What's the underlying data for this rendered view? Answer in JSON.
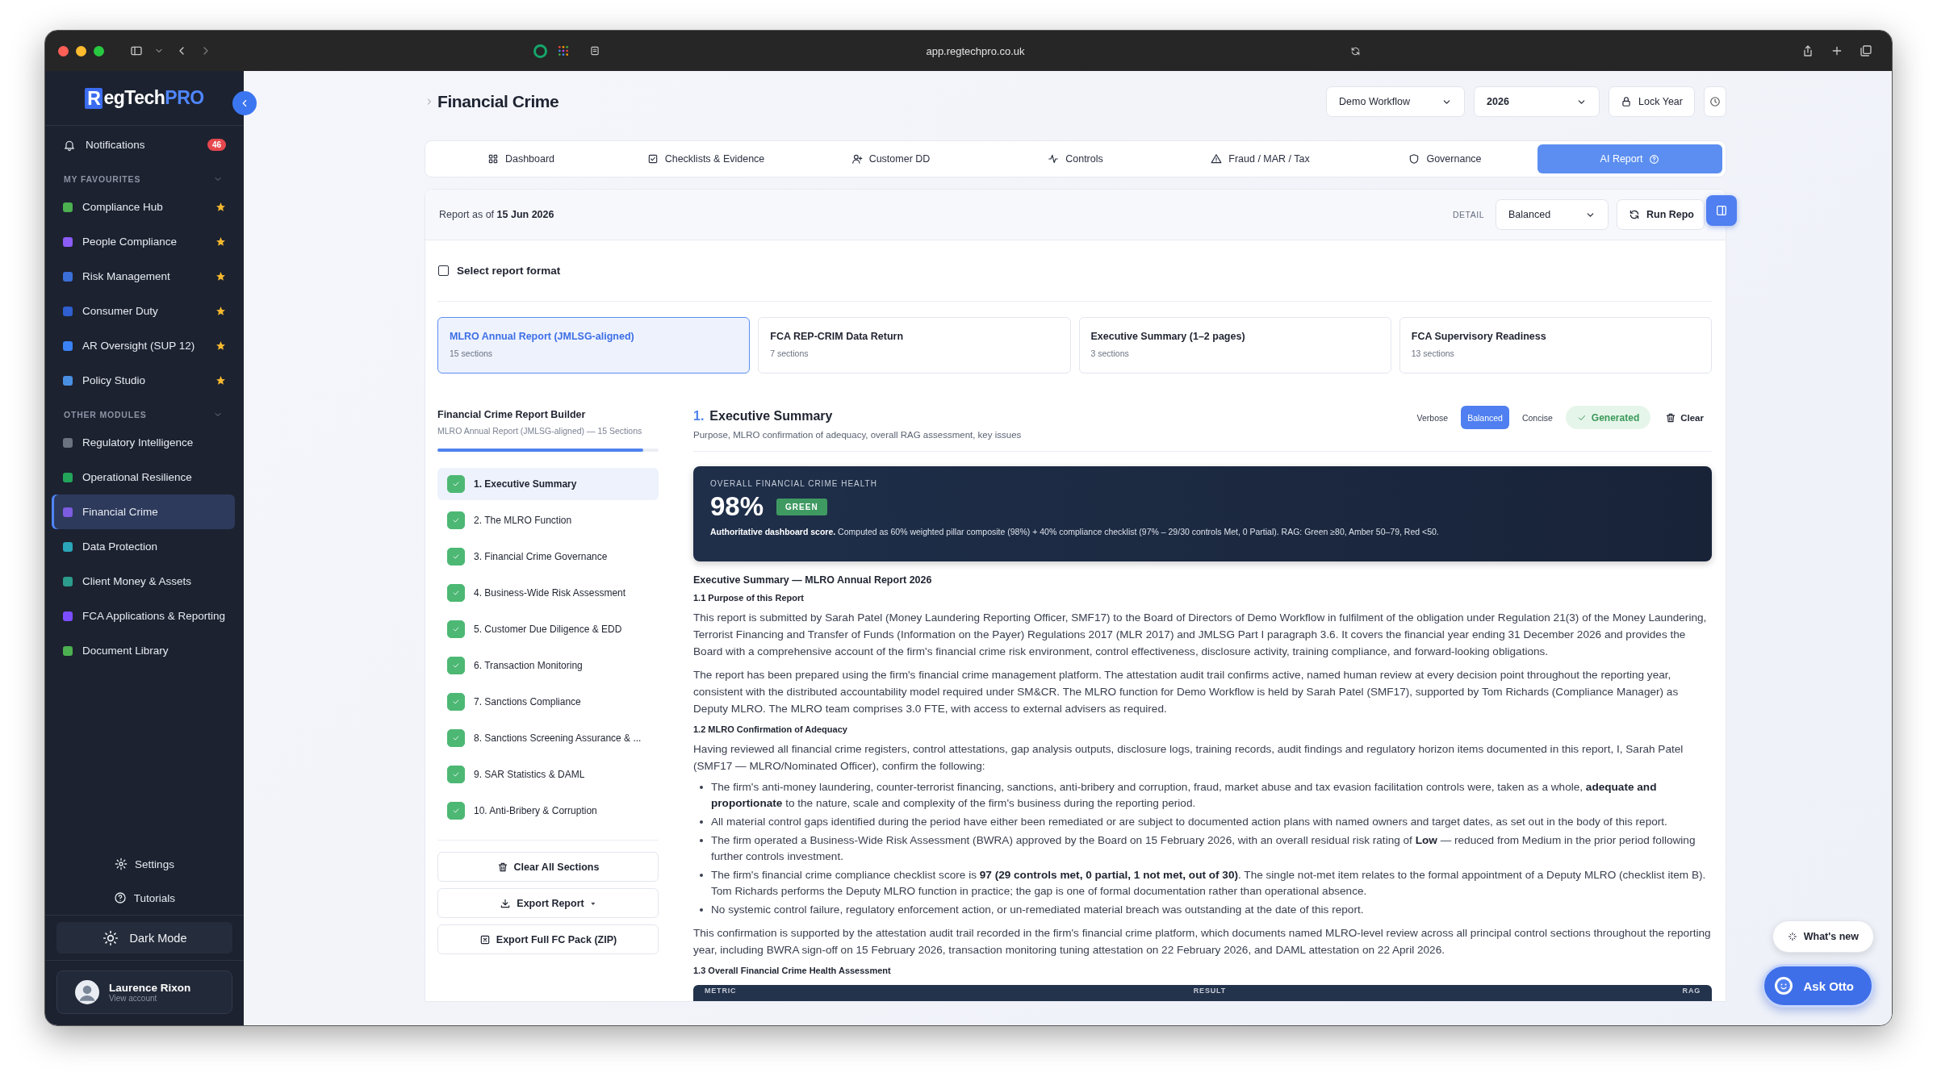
{
  "browser": {
    "url": "app.regtechpro.co.uk"
  },
  "sidebar": {
    "logo_mark": "R",
    "logo_text": "egTech",
    "logo_accent": "PRO",
    "notifications": {
      "label": "Notifications",
      "badge": "46"
    },
    "groups": [
      {
        "title": "MY FAVOURITES",
        "expanded": true,
        "items": [
          {
            "label": "Compliance Hub",
            "color": "#4caf50",
            "starred": true,
            "selected": false
          },
          {
            "label": "People Compliance",
            "color": "#8b5cf6",
            "starred": true,
            "selected": false
          },
          {
            "label": "Risk Management",
            "color": "#3b6fd8",
            "starred": true,
            "selected": false
          },
          {
            "label": "Consumer Duty",
            "color": "#2f5fd0",
            "starred": true,
            "selected": false
          },
          {
            "label": "AR Oversight (SUP 12)",
            "color": "#3b82f6",
            "starred": true,
            "selected": false
          },
          {
            "label": "Policy Studio",
            "color": "#4a90e2",
            "starred": true,
            "selected": false
          }
        ]
      },
      {
        "title": "OTHER MODULES",
        "expanded": true,
        "items": [
          {
            "label": "Regulatory Intelligence",
            "color": "#6b7280",
            "starred": false,
            "selected": false
          },
          {
            "label": "Operational Resilience",
            "color": "#22a55a",
            "starred": false,
            "selected": false
          },
          {
            "label": "Financial Crime",
            "color": "#7c5ce0",
            "starred": false,
            "selected": true
          },
          {
            "label": "Data Protection",
            "color": "#2aa6b8",
            "starred": false,
            "selected": false
          },
          {
            "label": "Client Money & Assets",
            "color": "#2c9c8c",
            "starred": false,
            "selected": false
          },
          {
            "label": "FCA Applications & Reporting",
            "color": "#7c4dff",
            "starred": false,
            "selected": false
          },
          {
            "label": "Document Library",
            "color": "#4caf50",
            "starred": false,
            "selected": false
          }
        ]
      }
    ],
    "footer": {
      "settings": "Settings",
      "tutorials": "Tutorials",
      "theme": "Dark Mode",
      "user": {
        "name": "Laurence Rixon",
        "subtitle": "View account"
      }
    }
  },
  "header": {
    "title": "Financial Crime",
    "workflow": "Demo Workflow",
    "year": "2026",
    "lock": "Lock Year"
  },
  "tabs": [
    {
      "label": "Dashboard",
      "selected": false
    },
    {
      "label": "Checklists & Evidence",
      "selected": false
    },
    {
      "label": "Customer DD",
      "selected": false
    },
    {
      "label": "Controls",
      "selected": false
    },
    {
      "label": "Fraud / MAR / Tax",
      "selected": false
    },
    {
      "label": "Governance",
      "selected": false
    },
    {
      "label": "AI Report",
      "selected": true
    }
  ],
  "report": {
    "as_of": "Report as of **15 Jun 2026**",
    "detail_label": "DETAIL",
    "detail_value": "Balanced",
    "run": "Run Repo"
  },
  "format": {
    "title": "Select report format",
    "checked": false,
    "cards": [
      {
        "title": "MLRO Annual Report (JMLSG-aligned)",
        "subtitle": "15 sections",
        "selected": true
      },
      {
        "title": "FCA REP-CRIM Data Return",
        "subtitle": "7 sections",
        "selected": false
      },
      {
        "title": "Executive Summary (1–2 pages)",
        "subtitle": "3 sections",
        "selected": false
      },
      {
        "title": "FCA Supervisory Readiness",
        "subtitle": "13 sections",
        "selected": false
      }
    ]
  },
  "builder": {
    "title": "Financial Crime Report Builder",
    "subtitle": "MLRO Annual Report (JMLSG-aligned) — 15 Sections",
    "level": 0.93,
    "sections": [
      {
        "label": "1. Executive Summary",
        "checked": true,
        "selected": true
      },
      {
        "label": "2. The MLRO Function",
        "checked": true,
        "selected": false
      },
      {
        "label": "3. Financial Crime Governance",
        "checked": true,
        "selected": false
      },
      {
        "label": "4. Business-Wide Risk Assessment",
        "checked": true,
        "selected": false
      },
      {
        "label": "5. Customer Due Diligence & EDD",
        "checked": true,
        "selected": false
      },
      {
        "label": "6. Transaction Monitoring",
        "checked": true,
        "selected": false
      },
      {
        "label": "7. Sanctions Compliance",
        "checked": true,
        "selected": false
      },
      {
        "label": "8. Sanctions Screening Assurance & ...",
        "checked": true,
        "selected": false
      },
      {
        "label": "9. SAR Statistics & DAML",
        "checked": true,
        "selected": false
      },
      {
        "label": "10. Anti-Bribery & Corruption",
        "checked": true,
        "selected": false
      }
    ],
    "buttons": [
      {
        "label": "Clear All Sections",
        "kind": "clear"
      },
      {
        "label": "Export Report",
        "kind": "export"
      },
      {
        "label": "Export Full FC Pack (ZIP)",
        "kind": "zip"
      }
    ]
  },
  "section": {
    "number": "1.",
    "title": "Executive Summary",
    "description": "Purpose, MLRO confirmation of adequacy, overall RAG assessment, key issues",
    "modes": [
      {
        "label": "Verbose",
        "selected": false
      },
      {
        "label": "Balanced",
        "selected": true
      },
      {
        "label": "Concise",
        "selected": false
      }
    ],
    "status": "Generated",
    "clear": "Clear"
  },
  "health": {
    "label": "OVERALL FINANCIAL CRIME HEALTH",
    "value": "98%",
    "rag": "GREEN",
    "note": "**Authoritative dashboard score.** Computed as 60% weighted pillar composite (98%) + 40% compliance checklist (97% – 29/30 controls Met, 0 Partial). RAG: Green ≥80, Amber 50–79, Red <50."
  },
  "document": [
    {
      "kind": "heading",
      "text": "Executive Summary — MLRO Annual Report 2026"
    },
    {
      "kind": "subheading",
      "text": "1.1 Purpose of this Report"
    },
    {
      "kind": "paragraph",
      "text": "This report is submitted by Sarah Patel (Money Laundering Reporting Officer, SMF17) to the Board of Directors of Demo Workflow in fulfilment of the obligation under Regulation 21(3) of the Money Laundering, Terrorist Financing and Transfer of Funds (Information on the Payer) Regulations 2017 (MLR 2017) and JMLSG Part I paragraph 3.6. It covers the financial year ending 31 December 2026 and provides the Board with a comprehensive account of the firm's financial crime risk environment, control effectiveness, disclosure activity, training compliance, and forward-looking obligations."
    },
    {
      "kind": "paragraph",
      "text": "The report has been prepared using the firm's financial crime management platform. The attestation audit trail confirms active, named human review at every decision point throughout the reporting year, consistent with the distributed accountability model required under SM&CR. The MLRO function for Demo Workflow is held by Sarah Patel (SMF17), supported by Tom Richards (Compliance Manager) as Deputy MLRO. The MLRO team comprises 3.0 FTE, with access to external advisers as required."
    },
    {
      "kind": "subheading",
      "text": "1.2 MLRO Confirmation of Adequacy"
    },
    {
      "kind": "paragraph",
      "text": "Having reviewed all financial crime registers, control attestations, gap analysis outputs, disclosure logs, training records, audit findings and regulatory horizon items documented in this report, I, Sarah Patel (SMF17 — MLRO/Nominated Officer), confirm the following:"
    },
    {
      "kind": "bullets",
      "items": [
        "The firm's anti-money laundering, counter-terrorist financing, sanctions, anti-bribery and corruption, fraud, market abuse and tax evasion facilitation controls were, taken as a whole, **adequate and proportionate** to the nature, scale and complexity of the firm's business during the reporting period.",
        "All material control gaps identified during the period have either been remediated or are subject to documented action plans with named owners and target dates, as set out in the body of this report.",
        "The firm operated a Business-Wide Risk Assessment (BWRA) approved by the Board on 15 February 2026, with an overall residual risk rating of **Low** — reduced from Medium in the prior period following further controls investment.",
        "The firm's financial crime compliance checklist score is **97 (29 controls met, 0 partial, 1 not met, out of 30)**. The single not-met item relates to the formal appointment of a Deputy MLRO (checklist item B). Tom Richards performs the Deputy MLRO function in practice; the gap is one of formal documentation rather than operational absence.",
        "No systemic control failure, regulatory enforcement action, or un-remediated material breach was outstanding at the date of this report."
      ]
    },
    {
      "kind": "paragraph",
      "text": "This confirmation is supported by the attestation audit trail recorded in the firm's financial crime platform, which documents named MLRO-level review across all principal control sections throughout the reporting year, including BWRA sign-off on 15 February 2026, transaction monitoring tuning attestation on 22 February 2026, and DAML attestation on 22 April 2026."
    },
    {
      "kind": "subheading",
      "text": "1.3 Overall Financial Crime Health Assessment"
    },
    {
      "kind": "table",
      "columns": [
        "METRIC",
        "RESULT",
        "RAG"
      ]
    }
  ],
  "widgets": {
    "whats_new": "What's new",
    "assistant": "Ask Otto"
  }
}
